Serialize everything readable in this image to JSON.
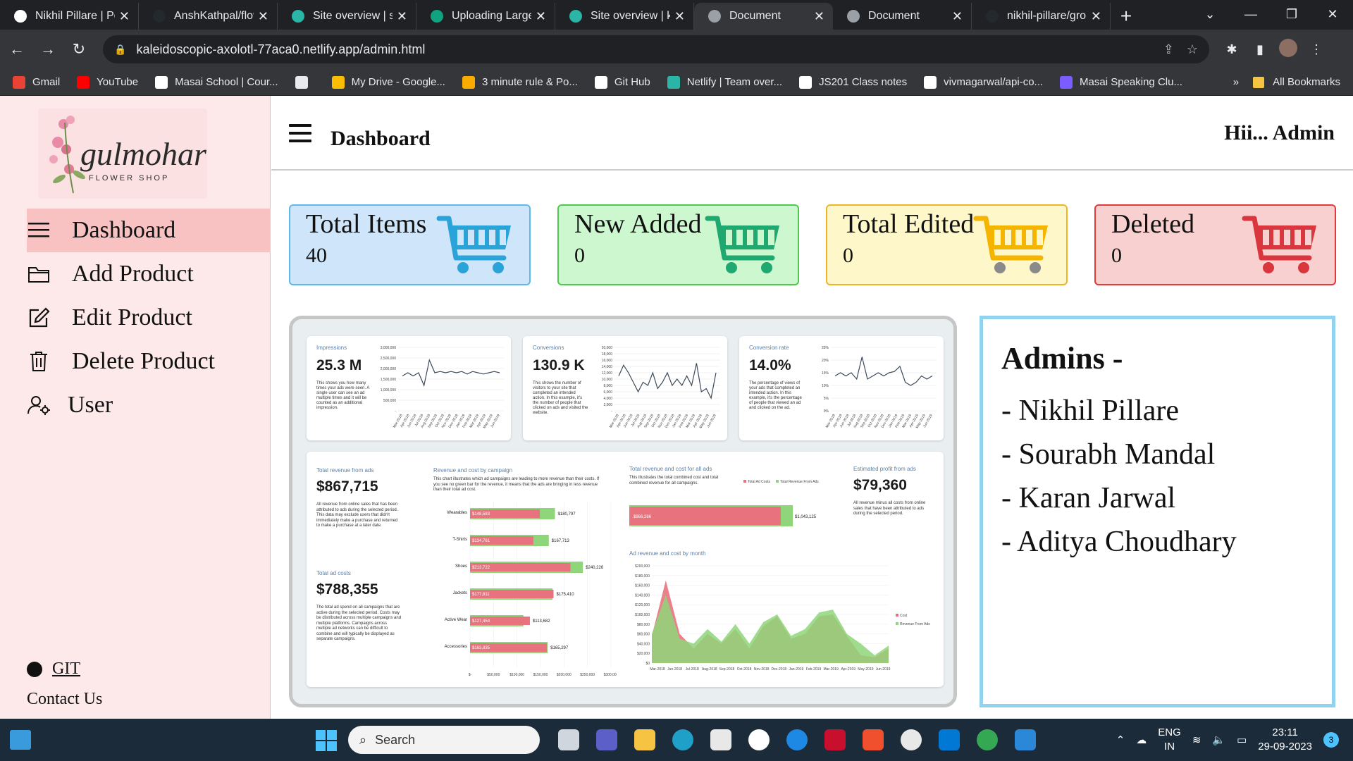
{
  "browser": {
    "tabs": [
      {
        "title": "Nikhil Pillare | Po",
        "color": "#ffffff"
      },
      {
        "title": "AnshKathpal/flov",
        "color": "#24292e"
      },
      {
        "title": "Site overview | st",
        "color": "#2bb5a6"
      },
      {
        "title": "Uploading Large",
        "color": "#10a37f"
      },
      {
        "title": "Site overview | ka",
        "color": "#2bb5a6"
      },
      {
        "title": "Document",
        "color": "#9aa0a6"
      },
      {
        "title": "Document",
        "color": "#9aa0a6"
      },
      {
        "title": "nikhil-pillare/gro",
        "color": "#24292e"
      }
    ],
    "url": "kaleidoscopic-axolotl-77aca0.netlify.app/admin.html",
    "bookmarks": [
      {
        "label": "Gmail",
        "color": "#ea4335"
      },
      {
        "label": "YouTube",
        "color": "#ff0000"
      },
      {
        "label": "Masai School | Cour...",
        "color": "#ffffff"
      },
      {
        "label": "",
        "color": "#e8eaed"
      },
      {
        "label": "My Drive - Google...",
        "color": "#fbbc04"
      },
      {
        "label": "3 minute rule & Po...",
        "color": "#f9ab00"
      },
      {
        "label": "Git Hub",
        "color": "#ffffff"
      },
      {
        "label": "Netlify | Team over...",
        "color": "#2bb5a6"
      },
      {
        "label": "JS201 Class notes",
        "color": "#ffffff"
      },
      {
        "label": "vivmagarwal/api-co...",
        "color": "#ffffff"
      },
      {
        "label": "Masai Speaking Clu...",
        "color": "#7b5cff"
      }
    ],
    "all_bookmarks": "All Bookmarks"
  },
  "sidebar": {
    "logo_script": "gulmohar",
    "logo_sub": "FLOWER SHOP",
    "items": [
      {
        "label": "Dashboard",
        "icon": "menu-icon"
      },
      {
        "label": "Add Product",
        "icon": "folder-icon"
      },
      {
        "label": "Edit Product",
        "icon": "edit-icon"
      },
      {
        "label": "Delete Product",
        "icon": "trash-icon"
      },
      {
        "label": "User",
        "icon": "user-settings-icon"
      }
    ],
    "git_label": "GIT",
    "contact_label": "Contact Us"
  },
  "header": {
    "title": "Dashboard",
    "greeting": "Hii... Admin"
  },
  "stats": [
    {
      "label": "Total Items",
      "value": "40",
      "bg": "#cfe5f9",
      "border": "#5fb8ea",
      "cart": "#2aa3d8"
    },
    {
      "label": "New Added",
      "value": "0",
      "bg": "#cdf7cf",
      "border": "#4ec94e",
      "cart": "#1fa870"
    },
    {
      "label": "Total Edited",
      "value": "0",
      "bg": "#fdf7c9",
      "border": "#f0b429",
      "cart": "#f5b400"
    },
    {
      "label": "Deleted",
      "value": "0",
      "bg": "#f9d0d0",
      "border": "#e23a3a",
      "cart": "#d9363e"
    }
  ],
  "dashboard": {
    "cards": [
      {
        "title": "Impressions",
        "value": "25.3 M",
        "desc": "This shows you how many times your ads were seen. A single user can see an ad multiple times and it will be counted as an additional impression.",
        "yticks": [
          "3,000,000",
          "2,500,000",
          "2,000,000",
          "1,500,000",
          "1,000,000",
          "500,000",
          "-"
        ]
      },
      {
        "title": "Conversions",
        "value": "130.9 K",
        "desc": "This shows the number of visitors to your site that completed an intended action. In this example, it's the number of people that clicked on ads and visited the website.",
        "yticks": [
          "20,000",
          "18,000",
          "16,000",
          "14,000",
          "12,000",
          "10,000",
          "8,000",
          "6,000",
          "4,000",
          "2,000",
          "-"
        ]
      },
      {
        "title": "Conversion rate",
        "value": "14.0%",
        "desc": "The percentage of views of your ads that completed an intended action. In this example, it's the percentage of people that viewed an ad and clicked on the ad.",
        "yticks": [
          "25%",
          "20%",
          "15%",
          "10%",
          "5%",
          "0%"
        ]
      }
    ],
    "revenue_label": "Total revenue from ads",
    "revenue_value": "$867,715",
    "revenue_desc": "All revenue from online sales that has been attributed to ads during the selected period. This data may exclude users that didn't immediately make a purchase and returned to make a purchase at a later date.",
    "cost_label": "Total ad costs",
    "cost_value": "$788,355",
    "cost_desc": "The total ad spend on all campaigns that are active during the selected period. Costs may be distributed across multiple campaigns and multiple platforms. Campaigns across multiple ad networks can be difficult to combine and will typically be displayed as separate campaigns.",
    "campaign_title": "Revenue and cost by campaign",
    "campaign_desc": "This chart illustrates which ad campaigns are leading to more revenue than their costs. If you see no green bar for the revenue, it means that the ads are bringing in less revenue than their total ad cost.",
    "campaigns": [
      {
        "name": "Wearables",
        "cost": "$148,583",
        "revenue": "$180,797"
      },
      {
        "name": "T-Shirts",
        "cost": "$134,761",
        "revenue": "$167,713"
      },
      {
        "name": "Shoes",
        "cost": "$213,722",
        "revenue": "$240,226"
      },
      {
        "name": "Jackets",
        "cost": "$177,811",
        "revenue": "$175,410"
      },
      {
        "name": "Active Wear",
        "cost": "$127,454",
        "revenue": "$113,682"
      },
      {
        "name": "Accessories",
        "cost": "$163,835",
        "revenue": "$165,297"
      }
    ],
    "campaign_xticks": [
      "$-",
      "$50,000",
      "$100,000",
      "$150,000",
      "$200,000",
      "$250,000",
      "$300,000"
    ],
    "total_title": "Total revenue and cost for all ads",
    "total_desc": "This illustrates the total combined cost and total combined revenue for all campaigns.",
    "total_legend": [
      "Total Ad Costs",
      "Total Revenue From Ads"
    ],
    "total_cost_label": "$966,266",
    "total_revenue_label": "$1,043,125",
    "profit_label": "Estimated profit from ads",
    "profit_value": "$79,360",
    "profit_desc": "All revenue minus all costs from online sales that have been attributed to ads during the selected period.",
    "month_title": "Ad revenue and cost by month",
    "month_legend": [
      "Cost",
      "Revenue From Ads"
    ],
    "month_yticks": [
      "$200,000",
      "$180,000",
      "$160,000",
      "$140,000",
      "$120,000",
      "$100,000",
      "$80,000",
      "$60,000",
      "$40,000",
      "$20,000",
      "$0"
    ],
    "month_xticks": [
      "Mar-2018",
      "Jun-2018",
      "Jul-2018",
      "Aug-2018",
      "Sep-2018",
      "Oct-2018",
      "Nov-2018",
      "Dec-2018",
      "Jan-2019",
      "Feb-2019",
      "Mar-2019",
      "Apr-2019",
      "May-2019",
      "Jun-2019"
    ],
    "colors": {
      "cost": "#e8737e",
      "revenue": "#8fd67a",
      "line": "#3d4a5a"
    }
  },
  "admins": {
    "title": "Admins -",
    "names": [
      "- Nikhil Pillare",
      "- Sourabh Mandal",
      "- Karan Jarwal",
      "- Aditya Choudhary"
    ]
  },
  "taskbar": {
    "search_label": "Search",
    "lang_top": "ENG",
    "lang_bottom": "IN",
    "time": "23:11",
    "date": "29-09-2023",
    "notifications": "3"
  }
}
